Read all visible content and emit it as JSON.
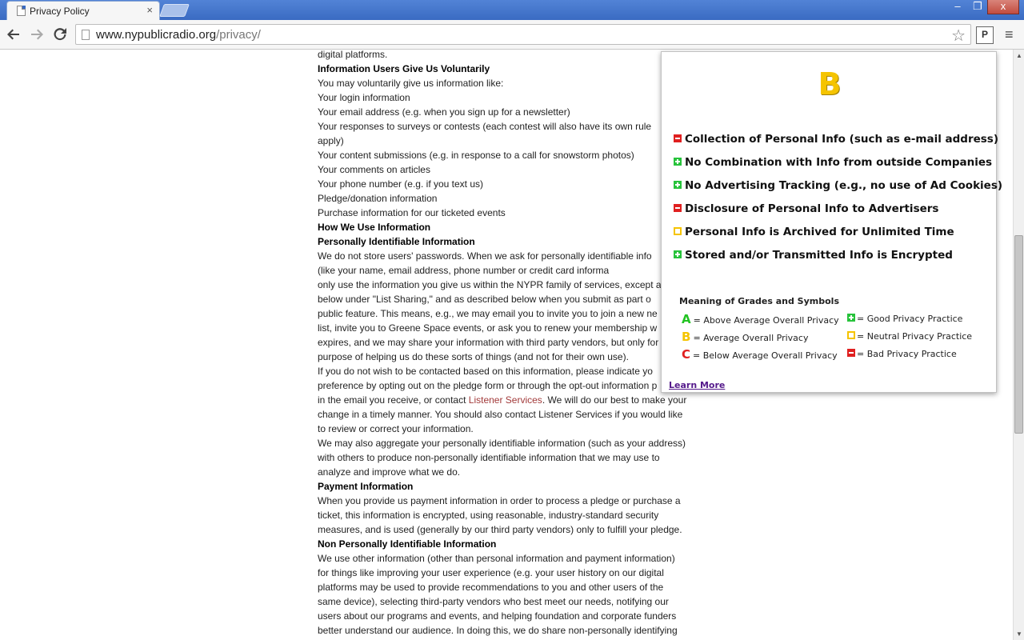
{
  "browser": {
    "tab_title": "Privacy Policy",
    "tab_close": "×",
    "url_host": "www.nypublicradio.org",
    "url_path": "/privacy/",
    "ext_label": "P",
    "window_min": "‒",
    "window_max": "❐",
    "window_close": "x"
  },
  "content": {
    "lines": [
      {
        "t": "digital platforms.",
        "h": false
      },
      {
        "t": "Information Users Give Us Voluntarily",
        "h": true
      },
      {
        "t": "You may voluntarily give us information like:",
        "h": false
      },
      {
        "t": "Your login information",
        "h": false
      },
      {
        "t": "Your email address (e.g. when you sign up for a newsletter)",
        "h": false
      },
      {
        "t": "Your responses to surveys or contests (each contest will also have its own rule",
        "h": false
      },
      {
        "t": "apply)",
        "h": false
      },
      {
        "t": "Your content submissions (e.g. in response to a call for snowstorm photos)",
        "h": false
      },
      {
        "t": "Your comments on articles",
        "h": false
      },
      {
        "t": "Your phone number (e.g. if you text us)",
        "h": false
      },
      {
        "t": "Pledge/donation information",
        "h": false
      },
      {
        "t": "Purchase information for our ticketed events",
        "h": false
      },
      {
        "t": "How We Use Information",
        "h": true
      },
      {
        "t": "Personally Identifiable Information",
        "h": true
      },
      {
        "t": "We do not store users' passwords. When we ask for personally identifiable info",
        "h": false
      },
      {
        "t": "(like your name, email address, phone number or credit card informa",
        "h": false
      },
      {
        "t": "only use the information you give us within the NYPR family of services, except a",
        "h": false
      },
      {
        "t": "below under \"List Sharing,\" and as described below when you submit as part o",
        "h": false
      },
      {
        "t": "public feature. This means, e.g., we may email you to invite you to join a new ne",
        "h": false
      },
      {
        "t": "list, invite you to Greene Space events, or ask you to renew your membership w",
        "h": false
      },
      {
        "t": "expires, and we may share your information with third party vendors, but only for",
        "h": false
      },
      {
        "t": "purpose of helping us do these sorts of things (and not for their own use).",
        "h": false
      },
      {
        "t": "If you do not wish to be contacted based on this information, please indicate yo",
        "h": false
      },
      {
        "t": "preference by opting out on the pledge form or through the opt-out information p",
        "h": false
      },
      {
        "t": "in the email you receive, or contact ",
        "h": false,
        "link": "Listener Services",
        "after": ". We will do our best to make your"
      },
      {
        "t": "change in a timely manner. You should also contact Listener Services if you would like",
        "h": false
      },
      {
        "t": "to review or correct your information.",
        "h": false
      },
      {
        "t": "We may also aggregate your personally identifiable information (such as your address)",
        "h": false
      },
      {
        "t": "with others to produce non-personally identifiable information that we may use to",
        "h": false
      },
      {
        "t": "analyze and improve what we do.",
        "h": false
      },
      {
        "t": "Payment Information",
        "h": true
      },
      {
        "t": "When you provide us payment information in order to process a pledge or purchase a",
        "h": false
      },
      {
        "t": "ticket, this information is encrypted, using reasonable, industry-standard security",
        "h": false
      },
      {
        "t": "measures, and is used (generally by our third party vendors) only to fulfill your pledge.",
        "h": false
      },
      {
        "t": "Non Personally Identifiable Information",
        "h": true
      },
      {
        "t": "We use other information (other than personal information and payment information)",
        "h": false
      },
      {
        "t": "for things like improving your user experience (e.g. your user history on our digital",
        "h": false
      },
      {
        "t": "platforms may be used to provide recommendations to you and other users of the",
        "h": false
      },
      {
        "t": "same device), selecting third-party vendors who best meet our needs, notifying our",
        "h": false
      },
      {
        "t": "users about our programs and events, and helping foundation and corporate funders",
        "h": false
      },
      {
        "t": "better understand our audience. In doing this, we do share non-personally identifying",
        "h": false
      }
    ]
  },
  "popup": {
    "grade": "B",
    "criteria": [
      {
        "label": "Collection of Personal Info (such as e-mail address)",
        "rating": "bad"
      },
      {
        "label": "No Combination with Info from outside Companies",
        "rating": "good"
      },
      {
        "label": "No Advertising Tracking (e.g., no use of Ad Cookies)",
        "rating": "good"
      },
      {
        "label": "Disclosure of Personal Info to Advertisers",
        "rating": "bad"
      },
      {
        "label": "Personal Info is Archived for Unlimited Time",
        "rating": "neutral"
      },
      {
        "label": "Stored and/or Transmitted Info is Encrypted",
        "rating": "good"
      }
    ],
    "legend_title": "Meaning of Grades and Symbols",
    "grades_legend": [
      {
        "letter": "A",
        "color": "#22c322",
        "text": "= Above Average Overall Privacy"
      },
      {
        "letter": "B",
        "color": "#f5c400",
        "text": "= Average Overall Privacy"
      },
      {
        "letter": "C",
        "color": "#e02020",
        "text": "= Below Average Overall Privacy"
      }
    ],
    "symbols_legend": [
      {
        "rating": "good",
        "text": "= Good Privacy Practice"
      },
      {
        "rating": "neutral",
        "text": "= Neutral Privacy Practice"
      },
      {
        "rating": "bad",
        "text": "= Bad Privacy Practice"
      }
    ],
    "learn_more": "Learn More"
  }
}
